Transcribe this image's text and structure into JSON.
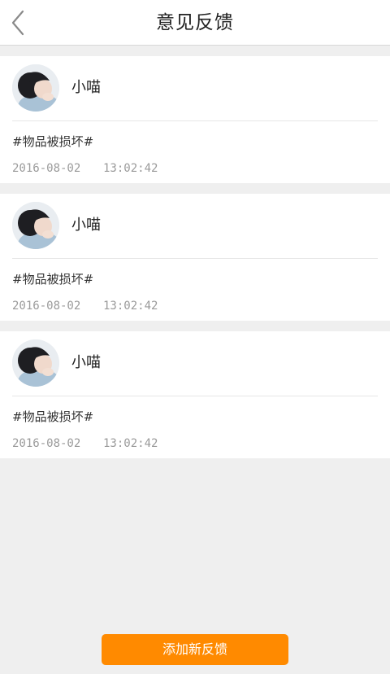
{
  "header": {
    "title": "意见反馈",
    "back_icon": "chevron-left-icon"
  },
  "feedback": [
    {
      "username": "小喵",
      "avatar_icon": "user-avatar-photo",
      "topic": "#物品被损坏#",
      "date": "2016-08-02",
      "time": "13:02:42"
    },
    {
      "username": "小喵",
      "avatar_icon": "user-avatar-photo",
      "topic": "#物品被损坏#",
      "date": "2016-08-02",
      "time": "13:02:42"
    },
    {
      "username": "小喵",
      "avatar_icon": "user-avatar-photo",
      "topic": "#物品被损坏#",
      "date": "2016-08-02",
      "time": "13:02:42"
    }
  ],
  "footer": {
    "add_label": "添加新反馈"
  },
  "colors": {
    "accent": "#ff8a00",
    "background": "#efefef",
    "card": "#ffffff",
    "meta_text": "#9a9a9a"
  }
}
